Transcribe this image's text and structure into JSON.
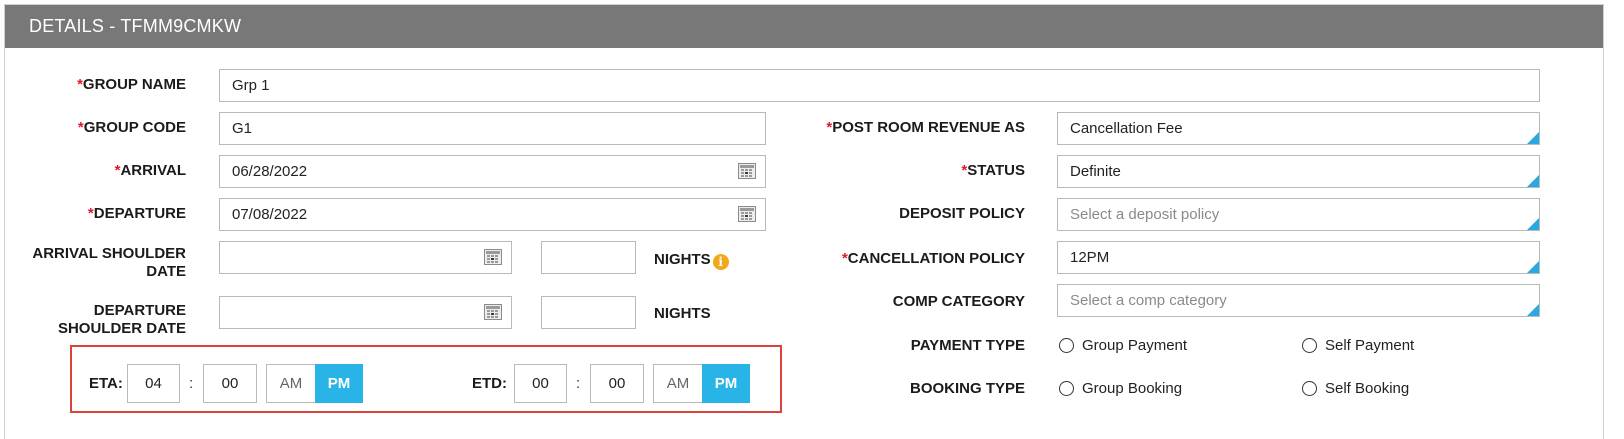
{
  "header": {
    "title": "DETAILS - TFMM9CMKW"
  },
  "left": {
    "group_name": {
      "label": "GROUP NAME",
      "required": "*",
      "value": "Grp 1"
    },
    "group_code": {
      "label": "GROUP CODE",
      "required": "*",
      "value": "G1"
    },
    "arrival": {
      "label": "ARRIVAL",
      "required": "*",
      "value": "06/28/2022"
    },
    "departure": {
      "label": "DEPARTURE",
      "required": "*",
      "value": "07/08/2022"
    },
    "arrival_shoulder": {
      "label_line1": "ARRIVAL SHOULDER",
      "label_line2": "DATE",
      "value": "",
      "nights_value": "",
      "nights_label": "NIGHTS"
    },
    "departure_shoulder": {
      "label_line1": "DEPARTURE",
      "label_line2": "SHOULDER DATE",
      "value": "",
      "nights_value": "",
      "nights_label": "NIGHTS"
    }
  },
  "right": {
    "post_room_revenue": {
      "label": "POST ROOM REVENUE AS",
      "required": "*",
      "value": "Cancellation Fee"
    },
    "status": {
      "label": "STATUS",
      "required": "*",
      "value": "Definite"
    },
    "deposit_policy": {
      "label": "DEPOSIT POLICY",
      "placeholder": "Select a deposit policy"
    },
    "cancellation_policy": {
      "label": "CANCELLATION POLICY",
      "required": "*",
      "value": "12PM"
    },
    "comp_category": {
      "label": "COMP CATEGORY",
      "placeholder": "Select a comp category"
    },
    "payment_type": {
      "label": "PAYMENT TYPE",
      "options": [
        "Group Payment",
        "Self Payment"
      ]
    },
    "booking_type": {
      "label": "BOOKING TYPE",
      "options": [
        "Group Booking",
        "Self Booking"
      ]
    }
  },
  "time": {
    "eta": {
      "label": "ETA:",
      "hour": "04",
      "minute": "00",
      "am": "AM",
      "pm": "PM",
      "selected": "PM"
    },
    "etd": {
      "label": "ETD:",
      "hour": "00",
      "minute": "00",
      "am": "AM",
      "pm": "PM",
      "selected": "PM"
    },
    "colon": ":"
  },
  "icons": {
    "info_glyph": "i",
    "accent_color": "#29b4e8",
    "required_color": "#e0182a",
    "highlight_color": "#d9443a"
  }
}
